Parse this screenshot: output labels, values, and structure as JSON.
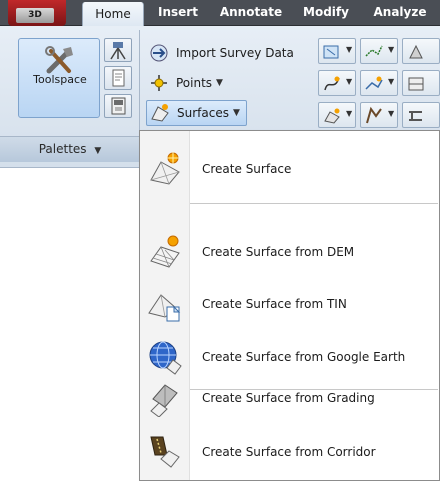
{
  "tabs": {
    "app_button": "3D",
    "items": [
      "Home",
      "Insert",
      "Annotate",
      "Modify",
      "Analyze"
    ]
  },
  "ribbon": {
    "toolspace_label": "Toolspace",
    "panel_title": "Palettes",
    "import_survey": "Import Survey Data",
    "points": "Points",
    "surfaces": "Surfaces"
  },
  "menu": {
    "items": [
      {
        "label": "Create Surface",
        "icon": "create-surface-icon"
      },
      {
        "label": "Create Surface from DEM",
        "icon": "surface-from-dem-icon"
      },
      {
        "label": "Create Surface from TIN",
        "icon": "surface-from-tin-icon"
      },
      {
        "label": "Create Surface from Google Earth",
        "icon": "surface-from-google-earth-icon"
      },
      {
        "label": "Create Surface from Grading",
        "icon": "surface-from-grading-icon"
      },
      {
        "label": "Create Surface from Corridor",
        "icon": "surface-from-corridor-icon"
      }
    ]
  },
  "colors": {
    "tabbar": "#4a4e55",
    "ribbon_bg": "#e7eef6",
    "selected_bg": "#b9d5f3",
    "menu_border": "#8c8c8c"
  }
}
